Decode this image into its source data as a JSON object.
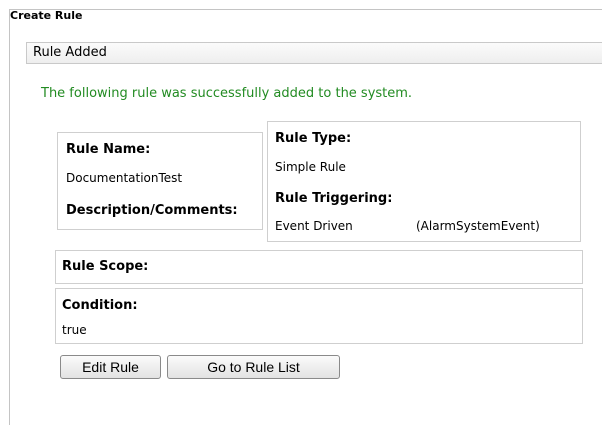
{
  "panel": {
    "title": "Create Rule"
  },
  "section": {
    "header": "Rule Added"
  },
  "message": "The following rule was successfully added to the system.",
  "rule": {
    "name_label": "Rule Name:",
    "name_value": "DocumentationTest",
    "description_label": "Description/Comments:",
    "type_label": "Rule Type:",
    "type_value": "Simple Rule",
    "triggering_label": "Rule Triggering:",
    "triggering_value": "Event Driven",
    "triggering_event": "(AlarmSystemEvent)",
    "scope_label": "Rule Scope:",
    "condition_label": "Condition:",
    "condition_value": "true"
  },
  "buttons": {
    "edit": "Edit Rule",
    "goto_list": "Go to Rule List"
  },
  "colors": {
    "success_text": "#228b22",
    "border": "#cfcfcf"
  }
}
